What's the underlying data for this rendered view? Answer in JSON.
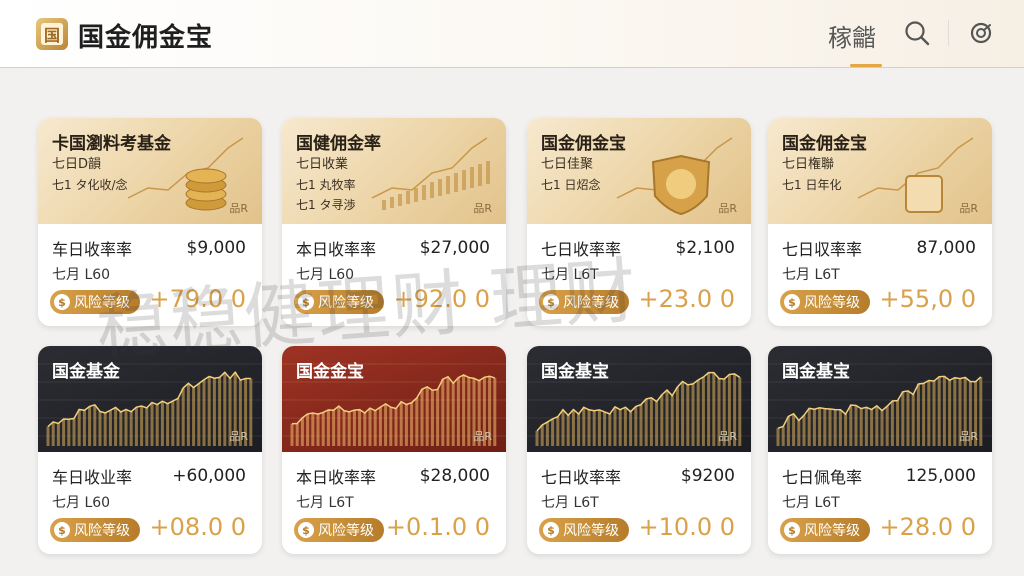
{
  "header": {
    "logo_glyph": "国",
    "title": "国金佣金宝",
    "nav_tab": "稼龤",
    "icons": [
      "search-icon",
      "target-icon"
    ],
    "accent": "#e3a745"
  },
  "watermark": "稳稳健理财 理财",
  "cards": [
    {
      "banner_style": "gold",
      "banner_art": "coins",
      "title": "卡国瀏料考基金",
      "sub1": "七日D韻",
      "sub2": "七1 タ化收/念",
      "sub3": "",
      "mark": "品R",
      "label": "车日收率率",
      "value": "$9,000",
      "label2": "七月 L60",
      "risk": "风险等级",
      "risk_glyph": "$",
      "change": "+79.0 0"
    },
    {
      "banner_style": "gold",
      "banner_art": "line",
      "title": "国健佣金率",
      "sub1": "七日收業",
      "sub2": "七1 丸牧率",
      "sub3": "七1 タ寻渉",
      "mark": "品R",
      "label": "本日收率率",
      "value": "$27,000",
      "label2": "七月 L60",
      "risk": "风险等级",
      "risk_glyph": "$",
      "change": "+92.0 0"
    },
    {
      "banner_style": "gold",
      "banner_art": "badge",
      "title": "国金佣金宝",
      "sub1": "七日佳聚",
      "sub2": "七1 日炤念",
      "sub3": "",
      "mark": "品R",
      "label": "七日收率率",
      "value": "$2,100",
      "label2": "七月 L6T",
      "risk": "风险等级",
      "risk_glyph": "$",
      "change": "+23.0 0"
    },
    {
      "banner_style": "gold",
      "banner_art": "box",
      "title": "国金佣金宝",
      "sub1": "七日権聯",
      "sub2": "七1 日年化",
      "sub3": "",
      "mark": "品R",
      "label": "七日収率率",
      "value": "87,000",
      "label2": "七月 L6T",
      "risk": "风险等级",
      "risk_glyph": "$",
      "change": "+55,0 0"
    },
    {
      "banner_style": "dark",
      "banner_art": "chart",
      "title": "国金基金",
      "sub1": "",
      "sub2": "",
      "sub3": "",
      "mark": "品R",
      "label": "车日收业率",
      "value": "+60,000",
      "label2": "七月 L60",
      "risk": "风险等级",
      "risk_glyph": "$",
      "change": "+08.0 0"
    },
    {
      "banner_style": "red",
      "banner_art": "chart",
      "title": "国金金宝",
      "sub1": "",
      "sub2": "",
      "sub3": "",
      "mark": "品R",
      "label": "本日收率率",
      "value": "$28,000",
      "label2": "七月 L6T",
      "risk": "风险等级",
      "risk_glyph": "$",
      "change": "+0.1.0 0"
    },
    {
      "banner_style": "dark",
      "banner_art": "chart",
      "title": "国金基宝",
      "sub1": "",
      "sub2": "",
      "sub3": "",
      "mark": "品R",
      "label": "七日收率率",
      "value": "$9200",
      "label2": "七月 L6T",
      "risk": "风险等级",
      "risk_glyph": "$",
      "change": "+10.0 0"
    },
    {
      "banner_style": "dark",
      "banner_art": "chart",
      "title": "国金基宝",
      "sub1": "",
      "sub2": "",
      "sub3": "",
      "mark": "品R",
      "label": "七日佩龟率",
      "value": "125,000",
      "label2": "七月 L6T",
      "risk": "风险等级",
      "risk_glyph": "$",
      "change": "+28.0 0"
    }
  ]
}
